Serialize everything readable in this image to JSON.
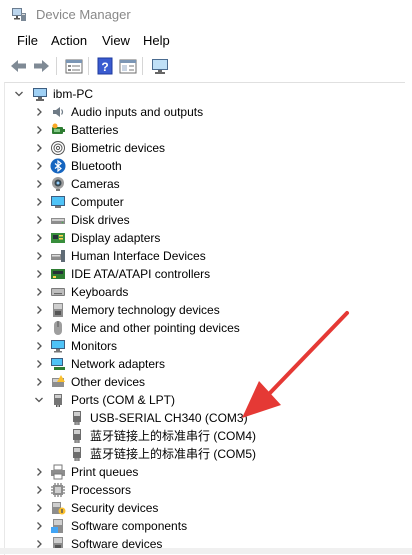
{
  "window": {
    "title": "Device Manager"
  },
  "menu": [
    "File",
    "Action",
    "View",
    "Help"
  ],
  "toolbar": {
    "buttons": [
      "back-arrow-icon",
      "forward-arrow-icon",
      "properties-icon",
      "help-icon",
      "view-icon",
      "monitor-icon"
    ]
  },
  "tree": {
    "root": "ibm-PC",
    "categories": [
      {
        "label": "Audio inputs and outputs",
        "icon": "audio-icon"
      },
      {
        "label": "Batteries",
        "icon": "battery-icon"
      },
      {
        "label": "Biometric devices",
        "icon": "fingerprint-icon"
      },
      {
        "label": "Bluetooth",
        "icon": "bluetooth-icon"
      },
      {
        "label": "Cameras",
        "icon": "camera-icon"
      },
      {
        "label": "Computer",
        "icon": "computer-icon"
      },
      {
        "label": "Disk drives",
        "icon": "disk-drive-icon"
      },
      {
        "label": "Display adapters",
        "icon": "display-adapter-icon"
      },
      {
        "label": "Human Interface Devices",
        "icon": "hid-icon"
      },
      {
        "label": "IDE ATA/ATAPI controllers",
        "icon": "ide-controller-icon"
      },
      {
        "label": "Keyboards",
        "icon": "keyboard-icon"
      },
      {
        "label": "Memory technology devices",
        "icon": "memory-icon"
      },
      {
        "label": "Mice and other pointing devices",
        "icon": "mouse-icon"
      },
      {
        "label": "Monitors",
        "icon": "monitor-icon"
      },
      {
        "label": "Network adapters",
        "icon": "network-adapter-icon"
      },
      {
        "label": "Other devices",
        "icon": "other-devices-icon"
      },
      {
        "label": "Ports (COM & LPT)",
        "icon": "port-icon",
        "expanded": true,
        "children": [
          "USB-SERIAL CH340 (COM3)",
          "蓝牙链接上的标准串行 (COM4)",
          "蓝牙链接上的标准串行 (COM5)"
        ]
      },
      {
        "label": "Print queues",
        "icon": "printer-icon"
      },
      {
        "label": "Processors",
        "icon": "processor-icon"
      },
      {
        "label": "Security devices",
        "icon": "security-icon"
      },
      {
        "label": "Software components",
        "icon": "software-component-icon"
      },
      {
        "label": "Software devices",
        "icon": "software-device-icon"
      }
    ]
  },
  "annotation": {
    "arrow_color": "#e53935"
  }
}
